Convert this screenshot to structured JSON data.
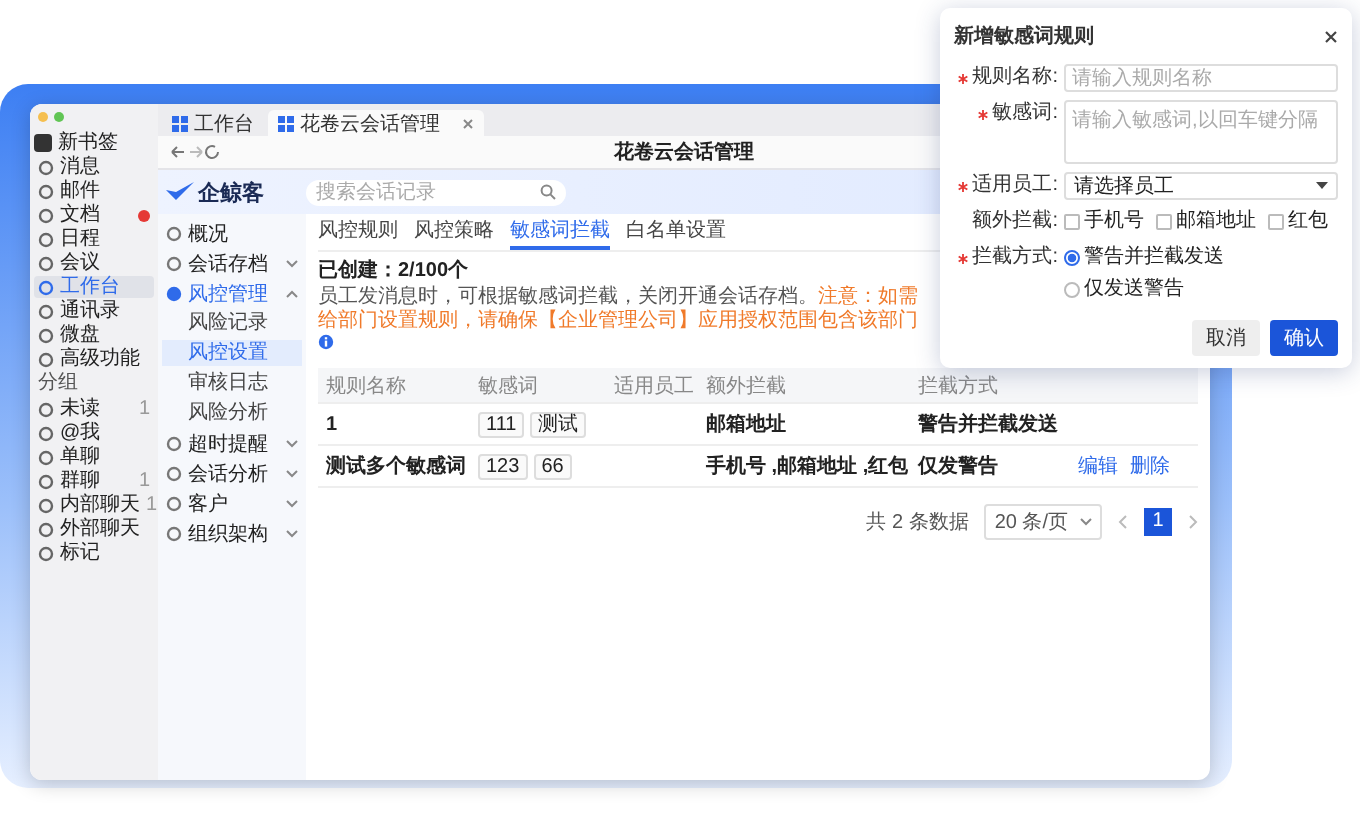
{
  "browser": {
    "tabs": [
      {
        "label": "工作台",
        "selected": false,
        "closable": false
      },
      {
        "label": "花卷云会话管理",
        "selected": true,
        "closable": true
      }
    ],
    "title": "花卷云会话管理"
  },
  "app_sidebar": {
    "profile": "新书签",
    "items": [
      {
        "label": "消息",
        "selected": false,
        "badge": false
      },
      {
        "label": "邮件",
        "selected": false,
        "badge": false
      },
      {
        "label": "文档",
        "selected": false,
        "badge": true
      },
      {
        "label": "日程",
        "selected": false,
        "badge": false
      },
      {
        "label": "会议",
        "selected": false,
        "badge": false
      },
      {
        "label": "工作台",
        "selected": true,
        "badge": false
      },
      {
        "label": "通讯录",
        "selected": false,
        "badge": false
      },
      {
        "label": "微盘",
        "selected": false,
        "badge": false
      },
      {
        "label": "高级功能",
        "selected": false,
        "badge": false
      }
    ],
    "group_title": "分组",
    "groups": [
      {
        "label": "未读",
        "count": "1"
      },
      {
        "label": "@我"
      },
      {
        "label": "单聊"
      },
      {
        "label": "群聊",
        "count": "1"
      },
      {
        "label": "内部聊天",
        "count": "1"
      },
      {
        "label": "外部聊天"
      },
      {
        "label": "标记"
      }
    ]
  },
  "logo": "企鲸客",
  "search": {
    "placeholder": "搜索会话记录"
  },
  "nav": [
    {
      "label": "概况",
      "selected": false
    },
    {
      "label": "会话存档",
      "selected": false,
      "expanded": false
    },
    {
      "label": "风控管理",
      "selected": true,
      "expanded": true,
      "children": [
        {
          "label": "风险记录",
          "selected": false
        },
        {
          "label": "风控设置",
          "selected": true
        },
        {
          "label": "审核日志",
          "selected": false
        },
        {
          "label": "风险分析",
          "selected": false
        }
      ]
    },
    {
      "label": "超时提醒",
      "selected": false,
      "expanded": false
    },
    {
      "label": "会话分析",
      "selected": false,
      "expanded": false
    },
    {
      "label": "客户",
      "selected": false,
      "expanded": false
    },
    {
      "label": "组织架构",
      "selected": false,
      "expanded": false
    }
  ],
  "content": {
    "tabs": [
      {
        "label": "风控规则",
        "selected": false
      },
      {
        "label": "风控策略",
        "selected": false
      },
      {
        "label": "敏感词拦截",
        "selected": true
      },
      {
        "label": "白名单设置",
        "selected": false
      }
    ],
    "created": "已创建：2/100个",
    "notice": "员工发消息时，可根据敏感词拦截，关闭开通会话存档。",
    "warning": "注意：如需给部门设置规则，请确保【企业管理公司】应用授权范围包含该部门",
    "table": {
      "columns": [
        "规则名称",
        "敏感词",
        "适用员工",
        "额外拦截",
        "拦截方式"
      ],
      "rows": [
        {
          "name": "1",
          "words": [
            "111",
            "测试"
          ],
          "extra": "邮箱地址",
          "mode": "警告并拦截发送"
        },
        {
          "name": "测试多个敏感词",
          "words": [
            "123",
            "66"
          ],
          "extra": "手机号 ,邮箱地址 ,红包",
          "mode": "仅发警告",
          "actions": [
            "编辑",
            "删除"
          ]
        }
      ]
    },
    "pagination": {
      "total": "共 2 条数据",
      "page_size": "20 条/页",
      "pages": [
        {
          "label": "1",
          "selected": true
        }
      ]
    }
  },
  "dialog": {
    "title": "新增敏感词规则",
    "fields": [
      {
        "kind": "text",
        "label": "规则名称:",
        "required": true,
        "placeholder": "请输入规则名称"
      },
      {
        "kind": "textarea",
        "label": "敏感词:",
        "required": true,
        "placeholder": "请输入敏感词,以回车键分隔"
      },
      {
        "kind": "select",
        "label": "适用员工:",
        "required": true,
        "value": "请选择员工"
      },
      {
        "kind": "checkboxes",
        "label": "额外拦截:",
        "required": false,
        "options": [
          {
            "label": "手机号",
            "checked": false
          },
          {
            "label": "邮箱地址",
            "checked": false
          },
          {
            "label": "红包",
            "checked": false
          }
        ]
      },
      {
        "kind": "radios",
        "label": "拦截方式:",
        "required": true,
        "options": [
          {
            "label": "警告并拦截发送",
            "selected": true
          },
          {
            "label": "仅发送警告",
            "selected": false
          }
        ]
      }
    ],
    "buttons": [
      {
        "label": "取消",
        "primary": false
      },
      {
        "label": "确认",
        "primary": true
      }
    ]
  }
}
